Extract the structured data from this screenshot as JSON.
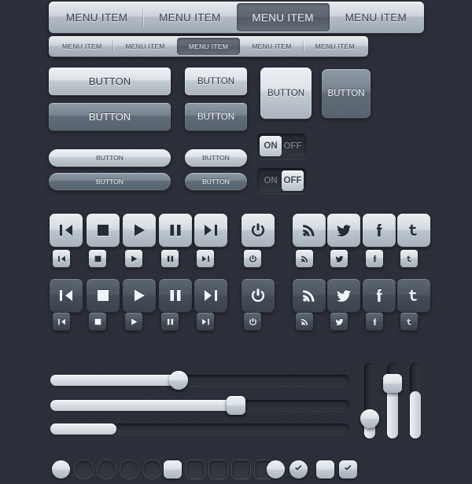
{
  "theme": {
    "background": "#2b2e38",
    "light_face": "#dde3e8",
    "dark_face": "#5f6b76",
    "text_dark": "#333c47",
    "text_light": "#f0f4f7",
    "track": "#23262d"
  },
  "menus": {
    "large_bar": {
      "name": "primary-menu-bar",
      "items": [
        {
          "label": "MENU ITEM",
          "active": false
        },
        {
          "label": "MENU ITEM",
          "active": false
        },
        {
          "label": "MENU ITEM",
          "active": true
        },
        {
          "label": "MENU ITEM",
          "active": false
        }
      ]
    },
    "small_bar": {
      "name": "secondary-menu-bar",
      "items": [
        {
          "label": "MENU ITEM",
          "active": false
        },
        {
          "label": "MENU ITEM",
          "active": false
        },
        {
          "label": "MENU ITEM",
          "active": true
        },
        {
          "label": "MENU ITEM",
          "active": false
        },
        {
          "label": "MENU ITEM",
          "active": false
        }
      ]
    }
  },
  "buttons": {
    "large_light": "BUTTON",
    "large_dark": "BUTTON",
    "medium_light": "BUTTON",
    "medium_dark": "BUTTON",
    "square_light": "BUTTON",
    "square_dark": "BUTTON",
    "pill_light": "BUTTON",
    "pill_dark": "BUTTON",
    "small_pill_light": "BUTTON",
    "small_pill_dark": "BUTTON"
  },
  "toggles": [
    {
      "name": "toggle-switch-on",
      "on_label": "ON",
      "off_label": "OFF",
      "state": "on"
    },
    {
      "name": "toggle-switch-off",
      "on_label": "ON",
      "off_label": "OFF",
      "state": "off"
    }
  ],
  "icon_sets": [
    {
      "name": "media-icons-light-large",
      "style": "light",
      "size": "large",
      "icons": [
        "rewind-icon",
        "stop-icon",
        "play-icon",
        "pause-icon",
        "fast-forward-icon",
        "power-icon",
        "rss-icon",
        "twitter-bird-icon",
        "facebook-icon",
        "twitter-t-icon"
      ]
    },
    {
      "name": "media-icons-light-small",
      "style": "light",
      "size": "small",
      "icons": [
        "rewind-icon",
        "stop-icon",
        "play-icon",
        "pause-icon",
        "fast-forward-icon",
        "power-icon",
        "rss-icon",
        "twitter-bird-icon",
        "facebook-icon",
        "twitter-t-icon"
      ]
    },
    {
      "name": "media-icons-dark-large",
      "style": "dark",
      "size": "large",
      "icons": [
        "rewind-icon",
        "stop-icon",
        "play-icon",
        "pause-icon",
        "fast-forward-icon",
        "power-icon",
        "rss-icon",
        "twitter-bird-icon",
        "facebook-icon",
        "twitter-t-icon"
      ]
    },
    {
      "name": "media-icons-dark-small",
      "style": "dark",
      "size": "small",
      "icons": [
        "rewind-icon",
        "stop-icon",
        "play-icon",
        "pause-icon",
        "fast-forward-icon",
        "power-icon",
        "rss-icon",
        "twitter-bird-icon",
        "facebook-icon",
        "twitter-t-icon"
      ]
    }
  ],
  "sliders": {
    "horizontal": [
      {
        "name": "slider-round-handle",
        "value": 43,
        "handle": "round"
      },
      {
        "name": "slider-square-handle",
        "value": 62,
        "handle": "square"
      },
      {
        "name": "progress-bar",
        "value": 22,
        "handle": "none"
      }
    ],
    "vertical": [
      {
        "name": "vslider-round-handle",
        "value": 26,
        "handle": "round"
      },
      {
        "name": "vslider-square-handle",
        "value": 73,
        "handle": "square"
      },
      {
        "name": "vprogress-bar",
        "value": 62,
        "handle": "none"
      }
    ]
  },
  "radios": [
    {
      "name": "radio-selected",
      "state": "filled"
    },
    {
      "name": "radio-empty-1",
      "state": "empty"
    },
    {
      "name": "radio-empty-2",
      "state": "empty"
    },
    {
      "name": "radio-empty-3",
      "state": "empty"
    },
    {
      "name": "radio-empty-4",
      "state": "empty"
    }
  ],
  "checkboxes": [
    {
      "name": "checkbox-selected",
      "state": "filled"
    },
    {
      "name": "checkbox-empty-1",
      "state": "empty"
    },
    {
      "name": "checkbox-empty-2",
      "state": "empty"
    },
    {
      "name": "checkbox-empty-3",
      "state": "empty"
    },
    {
      "name": "checkbox-empty-4",
      "state": "empty"
    }
  ],
  "check_variants": [
    {
      "name": "radio-filled-light",
      "shape": "circle",
      "state": "filled"
    },
    {
      "name": "radio-checkmark",
      "shape": "circle",
      "state": "checked"
    },
    {
      "name": "checkbox-filled-light",
      "shape": "square",
      "state": "filled"
    },
    {
      "name": "checkbox-checkmark",
      "shape": "square",
      "state": "checked"
    }
  ]
}
